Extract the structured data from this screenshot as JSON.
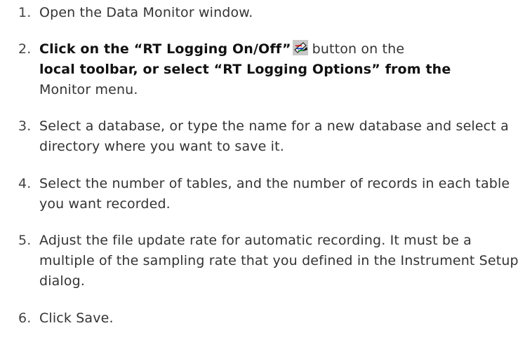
{
  "steps": [
    {
      "number": "1.",
      "text": "Open the Data Monitor window."
    },
    {
      "number": "2.",
      "line1_bold": "Click on the “RT Logging On/Off”",
      "icon": "rt-logging-toggle-icon",
      "line1_rest": "button on the",
      "line2_bold": "local toolbar, or select “RT Logging Options” from the",
      "line3": "Monitor menu."
    },
    {
      "number": "3.",
      "text": "Select a database, or type the name for a new database and select a directory where you want to save it."
    },
    {
      "number": "4.",
      "text": "Select the number of tables, and the number of records in each table you want recorded."
    },
    {
      "number": "5.",
      "text": "Adjust the file update rate for automatic recording. It must be a multiple of the sampling rate that you defined in the Instrument Setup dialog."
    },
    {
      "number": "6.",
      "text": "Click Save."
    }
  ]
}
